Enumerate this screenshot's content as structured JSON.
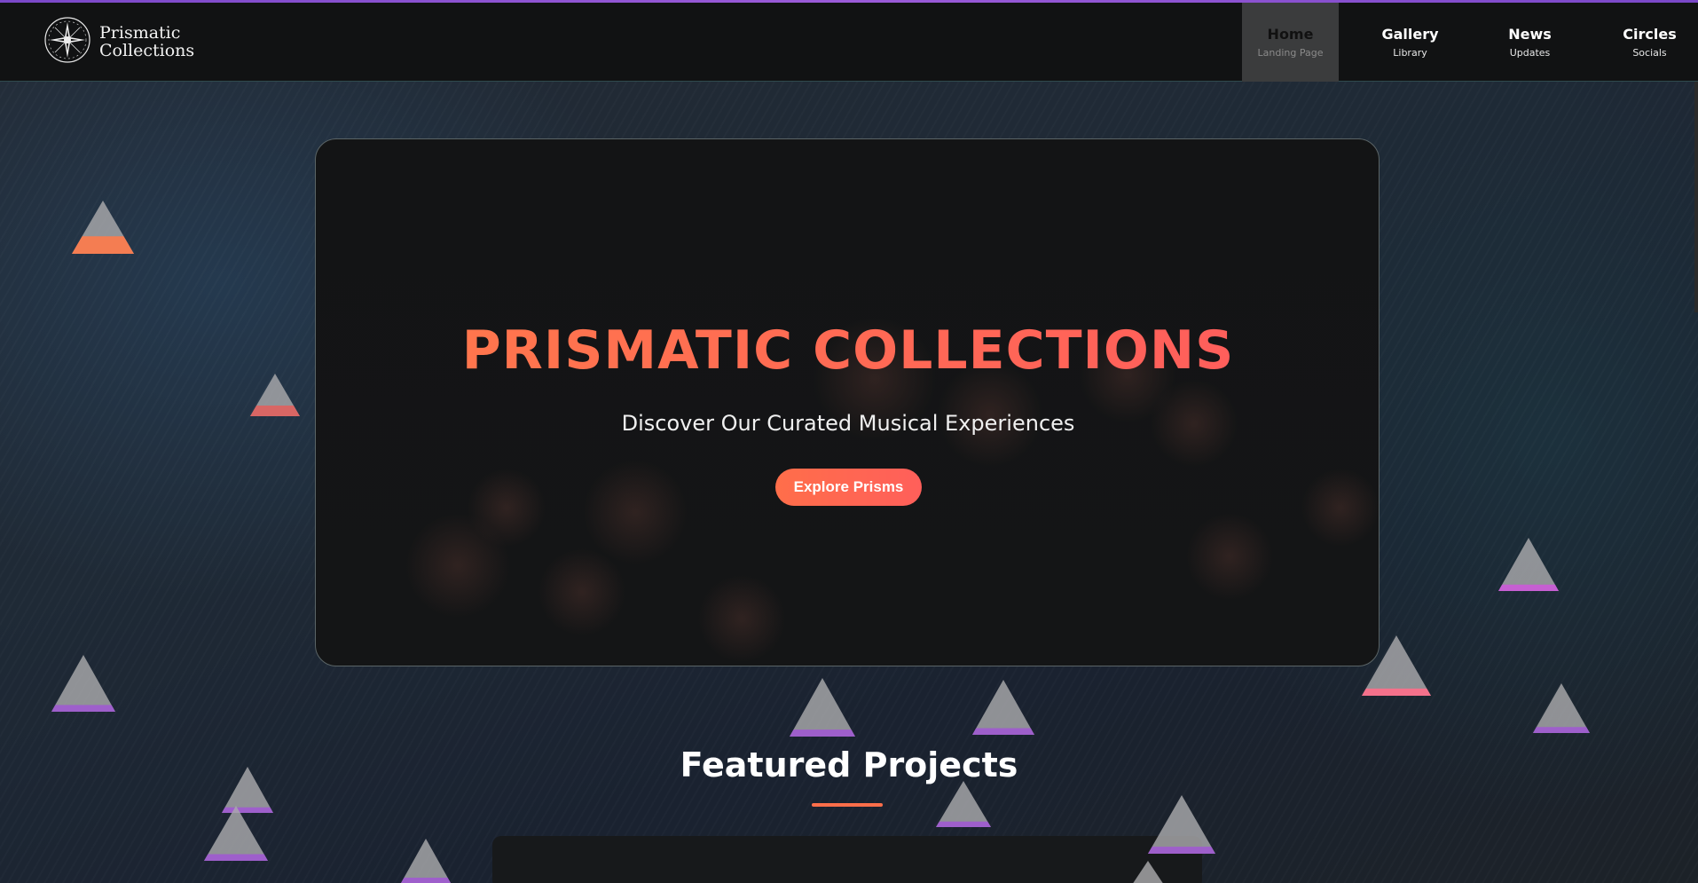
{
  "brand": {
    "line1": "Prismatic",
    "line2": "Collections",
    "logo_icon": "compass-star-icon"
  },
  "nav": {
    "items": [
      {
        "title": "Home",
        "sub": "Landing Page",
        "active": true
      },
      {
        "title": "Gallery",
        "sub": "Library",
        "active": false
      },
      {
        "title": "News",
        "sub": "Updates",
        "active": false
      },
      {
        "title": "Circles",
        "sub": "Socials",
        "active": false
      }
    ]
  },
  "hero": {
    "title": "PRISMATIC COLLECTIONS",
    "subtitle": "Discover Our Curated Musical Experiences",
    "cta_label": "Explore Prisms"
  },
  "featured": {
    "title": "Featured Projects"
  },
  "colors": {
    "accent": "#ff6e4a",
    "accent_alt": "#ff5a5e",
    "purple": "#9b5bd8",
    "header_bg": "#111213",
    "active_nav_bg": "#3b3c3d"
  }
}
